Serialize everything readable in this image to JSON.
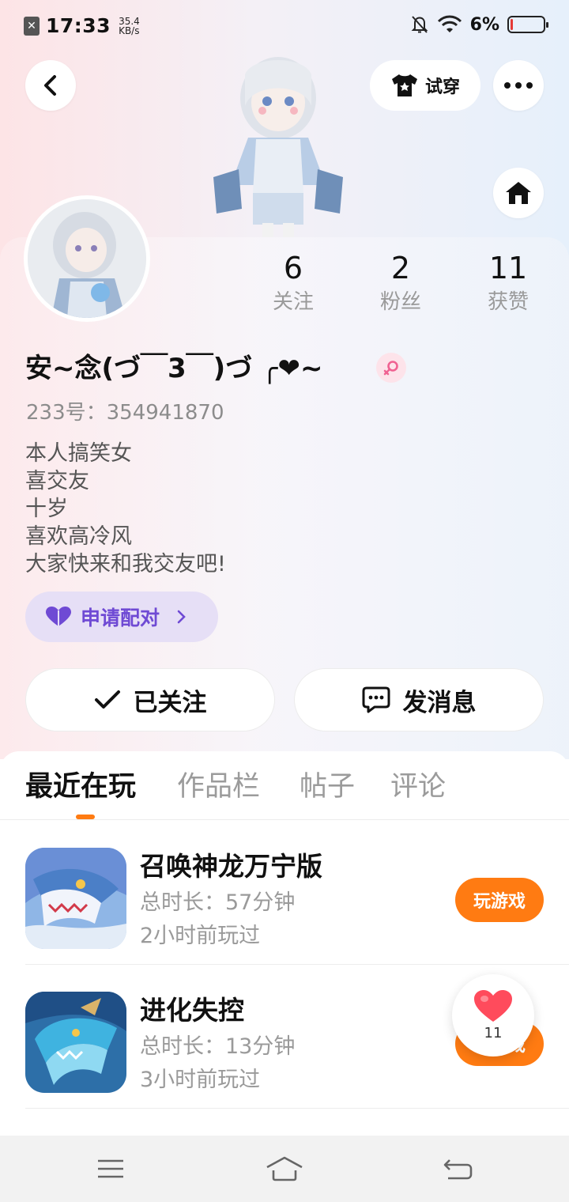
{
  "status_bar": {
    "time": "17:33",
    "net_speed_value": "35.4",
    "net_speed_unit": "KB/s",
    "battery_percent": "6%",
    "battery_level": 0.06
  },
  "header": {
    "try_on_label": "试穿",
    "icons": [
      "back-icon",
      "shirt-icon",
      "more-icon",
      "home-icon"
    ]
  },
  "profile": {
    "nickname": "安~念(づ￣3￣)づ ╭❤~",
    "gender": "female",
    "uid": "233号：354941870",
    "bio": [
      "本人搞笑女",
      "喜交友",
      "十岁",
      "喜欢高冷风",
      "大家快来和我交友吧!"
    ],
    "stats": [
      {
        "value": "6",
        "label": "关注"
      },
      {
        "value": "2",
        "label": "粉丝"
      },
      {
        "value": "11",
        "label": "获赞"
      }
    ],
    "pair_button": "申请配对",
    "follow_button": "已关注",
    "message_button": "发消息"
  },
  "tabs": [
    "最近在玩",
    "作品栏",
    "帖子",
    "评论"
  ],
  "active_tab": "最近在玩",
  "games": [
    {
      "name": "召唤神龙万宁版",
      "duration": "总时长：57分钟",
      "last_played": "2小时前玩过",
      "button": "玩游戏"
    },
    {
      "name": "进化失控",
      "duration": "总时长：13分钟",
      "last_played": "3小时前玩过",
      "button": "玩游戏"
    }
  ],
  "like_float": {
    "count": "11"
  },
  "colors": {
    "accent_orange": "#ff7b12",
    "pair_purple": "#6f4ad4",
    "pair_bg": "#e6dff6",
    "female_pink": "#f06292",
    "like_red": "#ff4b5c"
  }
}
